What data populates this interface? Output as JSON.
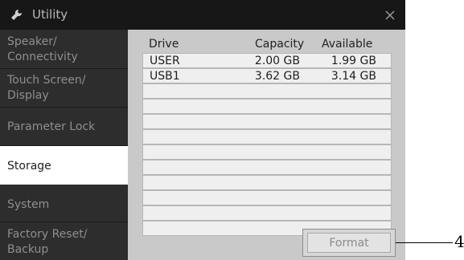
{
  "window": {
    "title": "Utility",
    "title_icon": "wrench-icon",
    "close_icon": "close-icon"
  },
  "sidebar": {
    "items": [
      {
        "label": "Speaker/\nConnectivity",
        "active": false
      },
      {
        "label": "Touch Screen/\nDisplay",
        "active": false
      },
      {
        "label": "Parameter Lock",
        "active": false
      },
      {
        "label": "Storage",
        "active": true
      },
      {
        "label": "System",
        "active": false
      },
      {
        "label": "Factory Reset/\nBackup",
        "active": false
      }
    ]
  },
  "table": {
    "headers": {
      "drive": "Drive",
      "capacity": "Capacity",
      "available": "Available"
    },
    "rows": [
      {
        "drive": "USER",
        "capacity": "2.00 GB",
        "available": "1.99 GB"
      },
      {
        "drive": "USB1",
        "capacity": "3.62 GB",
        "available": "3.14 GB"
      },
      {
        "drive": "",
        "capacity": "",
        "available": ""
      },
      {
        "drive": "",
        "capacity": "",
        "available": ""
      },
      {
        "drive": "",
        "capacity": "",
        "available": ""
      },
      {
        "drive": "",
        "capacity": "",
        "available": ""
      },
      {
        "drive": "",
        "capacity": "",
        "available": ""
      },
      {
        "drive": "",
        "capacity": "",
        "available": ""
      },
      {
        "drive": "",
        "capacity": "",
        "available": ""
      },
      {
        "drive": "",
        "capacity": "",
        "available": ""
      },
      {
        "drive": "",
        "capacity": "",
        "available": ""
      },
      {
        "drive": "",
        "capacity": "",
        "available": ""
      }
    ]
  },
  "format_button": {
    "label": "Format",
    "enabled": false
  },
  "callout": {
    "number": "4"
  }
}
